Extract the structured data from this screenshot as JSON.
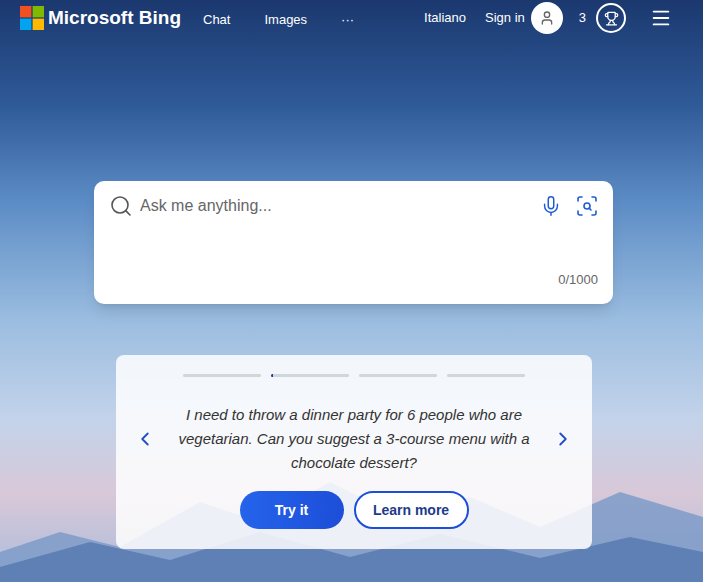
{
  "header": {
    "logo_text": "Microsoft Bing",
    "nav": [
      {
        "label": "Chat"
      },
      {
        "label": "Images"
      },
      {
        "label": "···"
      }
    ],
    "language": "Italiano",
    "sign_in": "Sign in",
    "rewards_count": "3"
  },
  "search": {
    "placeholder": "Ask me anything...",
    "counter": "0/1000"
  },
  "carousel": {
    "indicators": [
      {
        "level": 0,
        "selected": false
      },
      {
        "level": 0.02,
        "selected": true
      },
      {
        "level": 0,
        "selected": false
      },
      {
        "level": 0,
        "selected": false
      }
    ],
    "prompt": "I need to throw a dinner party for 6 people who are vegetarian. Can you suggest a 3-course menu with a chocolate dessert?",
    "buttons": [
      {
        "label": "Try it",
        "kind": "primary"
      },
      {
        "label": "Learn more",
        "kind": "secondary"
      }
    ]
  }
}
